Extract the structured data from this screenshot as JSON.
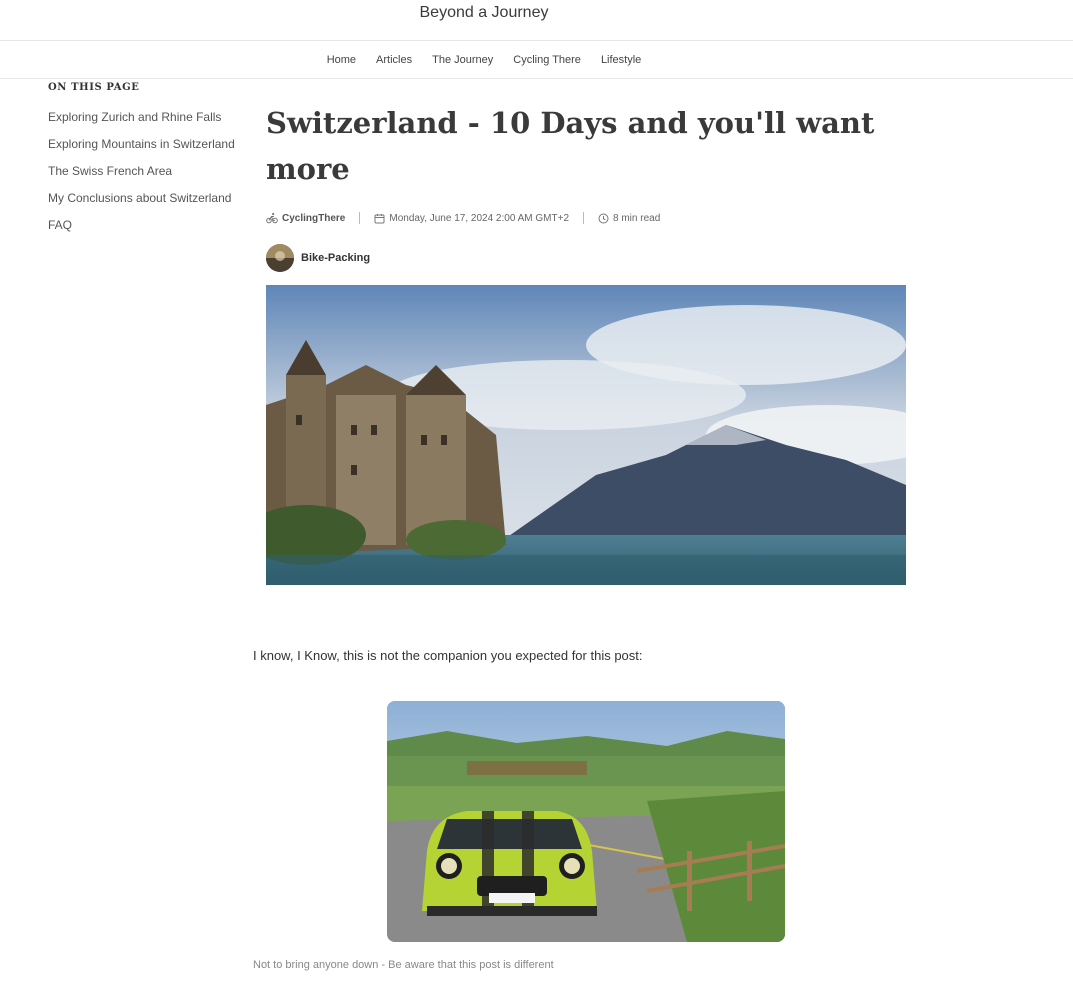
{
  "site": {
    "title": "Beyond a Journey"
  },
  "nav": {
    "items": [
      "Home",
      "Articles",
      "The Journey",
      "Cycling There",
      "Lifestyle"
    ]
  },
  "toc": {
    "heading": "ON THIS PAGE",
    "items": [
      "Exploring Zurich and Rhine Falls",
      "Exploring Mountains in Switzerland",
      "The Swiss French Area",
      "My Conclusions about Switzerland",
      "FAQ"
    ]
  },
  "article": {
    "title": "Switzerland - 10 Days and you'll want more",
    "author": "CyclingThere",
    "date": "Monday, June 17, 2024 2:00 AM GMT+2",
    "read_time": "8 min read",
    "tag": "Bike-Packing",
    "intro": "I know, I Know, this is not the companion you expected for this post:",
    "caption": "Not to bring anyone down - Be aware that this post is different"
  },
  "icons": {
    "author": "cyclist-icon",
    "date": "calendar-icon",
    "read_time": "clock-icon"
  },
  "colors": {
    "car_body": "#b5d433",
    "lake": "#3f6f82",
    "sky": "#a9bfd8"
  }
}
